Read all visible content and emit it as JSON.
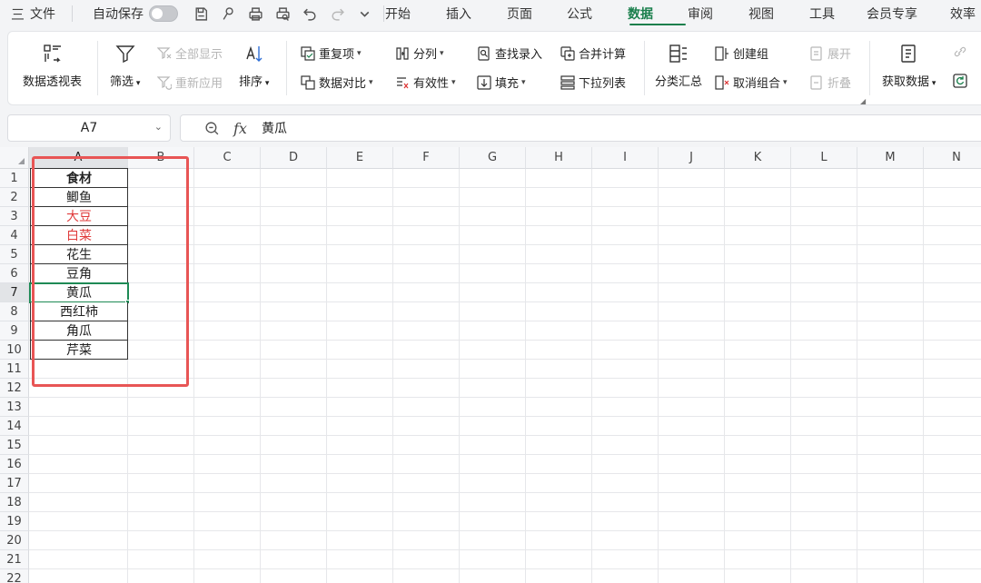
{
  "menubar": {
    "file_label": "文件",
    "hamburger_glyph": "三",
    "autosave_label": "自动保存",
    "autosave_on": false,
    "tabs": [
      {
        "label": "开始"
      },
      {
        "label": "插入"
      },
      {
        "label": "页面"
      },
      {
        "label": "公式"
      },
      {
        "label": "数据"
      },
      {
        "label": "审阅"
      },
      {
        "label": "视图"
      },
      {
        "label": "工具"
      },
      {
        "label": "会员专享"
      },
      {
        "label": "效率"
      }
    ],
    "active_tab": "数据",
    "accent_color": "#1a7f4c"
  },
  "ribbon": {
    "pivot": "数据透视表",
    "filter": "筛选",
    "show_all": "全部显示",
    "reapply": "重新应用",
    "sort": "排序",
    "duplicates": "重复项",
    "compare": "数据对比",
    "split": "分列",
    "validity": "有效性",
    "find_entry": "查找录入",
    "fill": "填充",
    "merge_calc": "合并计算",
    "dropdown_list": "下拉列表",
    "subtotal": "分类汇总",
    "create_group": "创建组",
    "ungroup": "取消组合",
    "expand": "展开",
    "collapse": "折叠",
    "get_data": "获取数据"
  },
  "formula_bar": {
    "name_box": "A7",
    "fx_label": "fx",
    "value": "黄瓜"
  },
  "grid": {
    "columns": [
      "A",
      "B",
      "C",
      "D",
      "E",
      "F",
      "G",
      "H",
      "I",
      "J",
      "K",
      "L",
      "M",
      "N"
    ],
    "rows": [
      "1",
      "2",
      "3",
      "4",
      "5",
      "6",
      "7",
      "8",
      "9",
      "10",
      "11",
      "12",
      "13",
      "14",
      "15",
      "16",
      "17",
      "18",
      "19",
      "20",
      "21",
      "22"
    ],
    "selected_column": "A",
    "selected_row": "7",
    "cells": [
      {
        "value": "食材",
        "style": "head"
      },
      {
        "value": "鲫鱼",
        "style": ""
      },
      {
        "value": "大豆",
        "style": "red"
      },
      {
        "value": "白菜",
        "style": "red"
      },
      {
        "value": "花生",
        "style": ""
      },
      {
        "value": "豆角",
        "style": ""
      },
      {
        "value": "黄瓜",
        "style": "active"
      },
      {
        "value": "西红柿",
        "style": ""
      },
      {
        "value": "角瓜",
        "style": ""
      },
      {
        "value": "芹菜",
        "style": ""
      }
    ],
    "highlight_text_color": "#e03b3b",
    "annotation_color": "#e85555"
  }
}
